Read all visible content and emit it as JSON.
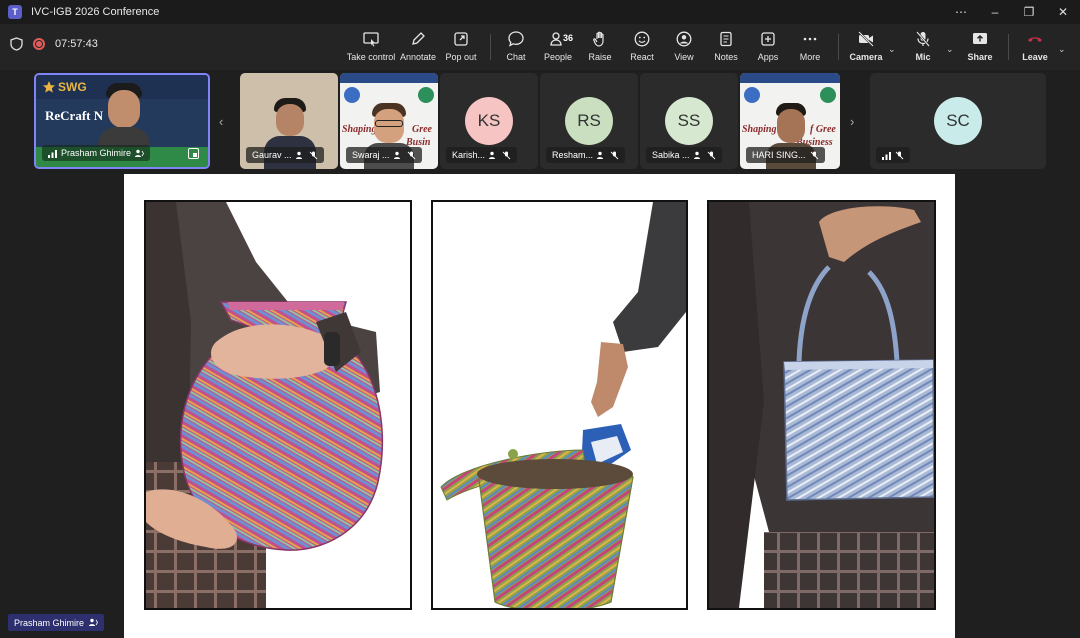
{
  "window": {
    "title": "IVC-IGB 2026 Conference",
    "app_icon": "teams-icon",
    "app_letter": "T",
    "controls": [
      "more-icon",
      "minimize-icon",
      "restore-icon",
      "close-icon"
    ]
  },
  "meeting": {
    "elapsed": "07:57:43",
    "people_count": "36"
  },
  "toolbar": {
    "take_control": "Take control",
    "annotate": "Annotate",
    "pop_out": "Pop out",
    "chat": "Chat",
    "people": "People",
    "raise": "Raise",
    "react": "React",
    "view": "View",
    "notes": "Notes",
    "apps": "Apps",
    "more": "More",
    "camera": "Camera",
    "mic": "Mic",
    "share": "Share",
    "leave": "Leave"
  },
  "participants": [
    {
      "name": "Prasham Ghimire",
      "type": "video",
      "slide_text": "ReCraft N",
      "logo": "SWG"
    },
    {
      "name": "Gaurav ...",
      "type": "video"
    },
    {
      "name": "Swaraj ...",
      "type": "video",
      "slide_text": "Shaping the",
      "slide_text2": "Gree",
      "slide_text3": "Busin"
    },
    {
      "name": "Karish...",
      "type": "avatar",
      "initials": "KS",
      "color": "#f7c4c4"
    },
    {
      "name": "Resham...",
      "type": "avatar",
      "initials": "RS",
      "color": "#c9dfc0"
    },
    {
      "name": "Sabika ...",
      "type": "avatar",
      "initials": "SS",
      "color": "#d7e8d0"
    },
    {
      "name": "HARI SING...",
      "type": "video",
      "slide_text": "Shaping the",
      "slide_text2": "f Gree",
      "slide_text3": "Business"
    },
    {
      "name": "",
      "type": "avatar",
      "initials": "SC",
      "color": "#c9eceb"
    }
  ],
  "presenter_label": "Prasham Ghimire",
  "colors": {
    "accent": "#7f85f5",
    "leave": "#c4314b",
    "record": "#e25c5c"
  }
}
